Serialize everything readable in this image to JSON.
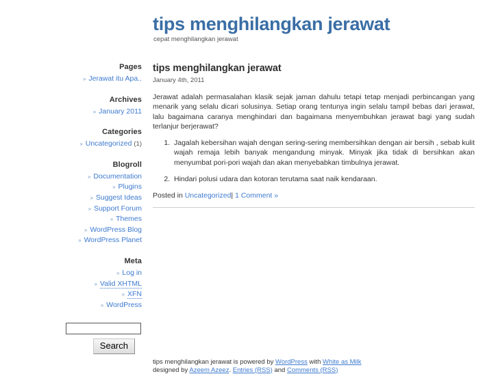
{
  "header": {
    "title": "tips menghilangkan jerawat",
    "description": "cepat menghilangkan jerawat"
  },
  "sidebar": {
    "bullet": "»",
    "widgets": [
      {
        "title": "Pages",
        "items": [
          {
            "label": "Jerawat itu Apa..",
            "count": ""
          }
        ]
      },
      {
        "title": "Archives",
        "items": [
          {
            "label": "January 2011",
            "count": ""
          }
        ]
      },
      {
        "title": "Categories",
        "items": [
          {
            "label": "Uncategorized",
            "count": "(1)"
          }
        ]
      },
      {
        "title": "Blogroll",
        "items": [
          {
            "label": "Documentation",
            "count": ""
          },
          {
            "label": "Plugins",
            "count": ""
          },
          {
            "label": "Suggest Ideas",
            "count": ""
          },
          {
            "label": "Support Forum",
            "count": ""
          },
          {
            "label": "Themes",
            "count": ""
          },
          {
            "label": "WordPress Blog",
            "count": ""
          },
          {
            "label": "WordPress Planet",
            "count": ""
          }
        ]
      },
      {
        "title": "Meta",
        "items": [
          {
            "label": "Log in",
            "count": ""
          },
          {
            "label": "Valid XHTML",
            "count": "",
            "abbr": true
          },
          {
            "label": "XFN",
            "count": "",
            "abbr": true
          },
          {
            "label": "WordPress",
            "count": ""
          }
        ]
      }
    ],
    "search": {
      "value": "",
      "placeholder": "",
      "button_label": "Search"
    }
  },
  "main": {
    "post": {
      "title": "tips menghilangkan jerawat",
      "date": "January 4th, 2011",
      "paragraph": "Jerawat adalah permasalahan klasik sejak jaman dahulu tetapi tetap menjadi perbincangan yang menarik yang selalu dicari solusinya. Setiap orang tentunya ingin selalu tampil bebas dari jerawat, lalu bagaimana caranya menghindari dan bagaimana menyembuhkan jerawat bagi yang sudah terlanjur berjerawat?",
      "list": [
        "Jagalah kebersihan wajah dengan sering-sering membersihkan dengan air bersih , sebab kulit wajah remaja lebih banyak mengandung minyak.   Minyak jika tidak di bersihkan akan menyumbat pori-pori wajah dan akan menyebabkan timbulnya jerawat.",
        "Hindari polusi udara dan kotoran terutama saat naik kendaraan."
      ],
      "meta": {
        "posted_in_label": "Posted in",
        "category": "Uncategorized",
        "separator": "|",
        "comments": "1 Comment »"
      }
    }
  },
  "footer": {
    "line1_part1": "tips menghilangkan jerawat is powered by",
    "line1_link1": "WordPress",
    "line1_part2": "with",
    "line1_link2": "White as Milk",
    "line2_part1": "designed by",
    "line2_link1": "Azeem Azeez",
    "line2_part2": ".",
    "line2_link2": "Entries (RSS)",
    "line2_part3": "and",
    "line2_link3": "Comments (RSS)"
  },
  "colors": {
    "brand_blue": "#3a6ea5",
    "link_blue": "#3d7ad0",
    "text": "#333333",
    "divider": "#cfcfcf"
  }
}
